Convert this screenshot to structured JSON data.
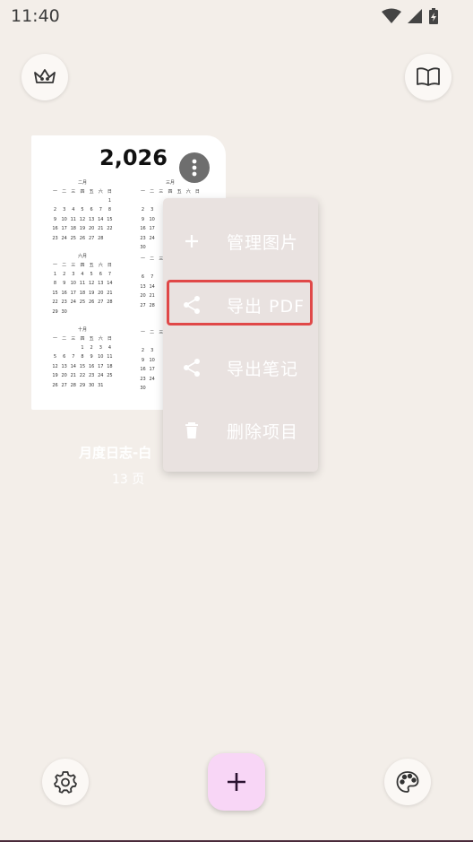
{
  "status": {
    "time": "11:40"
  },
  "card": {
    "year": "2,026",
    "title": "月度日志-白",
    "pages": "13 页",
    "weekdays": [
      "一",
      "二",
      "三",
      "四",
      "五",
      "六",
      "日"
    ],
    "months": [
      {
        "name": "二月",
        "rows": [
          [
            "",
            "",
            "",
            "",
            "",
            "",
            "1"
          ],
          [
            "2",
            "3",
            "4",
            "5",
            "6",
            "7",
            "8"
          ],
          [
            "9",
            "10",
            "11",
            "12",
            "13",
            "14",
            "15"
          ],
          [
            "16",
            "17",
            "18",
            "19",
            "20",
            "21",
            "22"
          ],
          [
            "23",
            "24",
            "25",
            "26",
            "27",
            "28",
            ""
          ]
        ]
      },
      {
        "name": "三月",
        "rows": [
          [
            "",
            "",
            "",
            "",
            "",
            "",
            ""
          ],
          [
            "2",
            "3",
            "",
            "",
            "",
            "",
            ""
          ],
          [
            "9",
            "10",
            "",
            "",
            "",
            "",
            ""
          ],
          [
            "16",
            "17",
            "",
            "",
            "",
            "",
            ""
          ],
          [
            "23",
            "24",
            "",
            "",
            "",
            "",
            ""
          ],
          [
            "30",
            "",
            "",
            "",
            "",
            "",
            ""
          ]
        ]
      },
      {
        "name": "六月",
        "rows": [
          [
            "1",
            "2",
            "3",
            "4",
            "5",
            "6",
            "7"
          ],
          [
            "8",
            "9",
            "10",
            "11",
            "12",
            "13",
            "14"
          ],
          [
            "15",
            "16",
            "17",
            "18",
            "19",
            "20",
            "21"
          ],
          [
            "22",
            "23",
            "24",
            "25",
            "26",
            "27",
            "28"
          ],
          [
            "29",
            "30",
            "",
            "",
            "",
            "",
            ""
          ]
        ]
      },
      {
        "name": "",
        "rows": [
          [
            "",
            "",
            "",
            "",
            "",
            "",
            ""
          ],
          [
            "6",
            "7",
            "",
            "",
            "",
            "",
            ""
          ],
          [
            "13",
            "14",
            "",
            "",
            "",
            "",
            ""
          ],
          [
            "20",
            "21",
            "",
            "",
            "",
            "",
            ""
          ],
          [
            "27",
            "28",
            "",
            "",
            "",
            "",
            ""
          ]
        ]
      },
      {
        "name": "十月",
        "rows": [
          [
            "",
            "",
            "",
            "1",
            "2",
            "3",
            "4"
          ],
          [
            "5",
            "6",
            "7",
            "8",
            "9",
            "10",
            "11"
          ],
          [
            "12",
            "13",
            "14",
            "15",
            "16",
            "17",
            "18"
          ],
          [
            "19",
            "20",
            "21",
            "22",
            "23",
            "24",
            "25"
          ],
          [
            "26",
            "27",
            "28",
            "29",
            "30",
            "31",
            ""
          ]
        ]
      },
      {
        "name": "",
        "rows": [
          [
            "",
            "",
            "",
            "",
            "",
            "",
            ""
          ],
          [
            "2",
            "3",
            "",
            "",
            "",
            "",
            ""
          ],
          [
            "9",
            "10",
            "",
            "",
            "",
            "",
            ""
          ],
          [
            "16",
            "17",
            "",
            "",
            "",
            "",
            ""
          ],
          [
            "23",
            "24",
            "",
            "",
            "",
            "",
            ""
          ],
          [
            "30",
            "",
            "",
            "",
            "",
            "",
            ""
          ]
        ]
      }
    ]
  },
  "menu": {
    "items": [
      {
        "label": "管理图片",
        "icon": "plus-icon"
      },
      {
        "label": "导出 PDF",
        "icon": "share-icon"
      },
      {
        "label": "导出笔记",
        "icon": "share-icon"
      },
      {
        "label": "删除项目",
        "icon": "trash-icon"
      }
    ]
  },
  "icons": {
    "top_left": "crown-icon",
    "top_right": "book-icon",
    "bottom_left": "gear-icon",
    "bottom_right": "palette-icon",
    "fab": "plus-icon"
  },
  "colors": {
    "background": "#f3eee9",
    "fab": "#f8d6f6",
    "highlight": "#e04848",
    "menu": "#e9e2e0"
  }
}
